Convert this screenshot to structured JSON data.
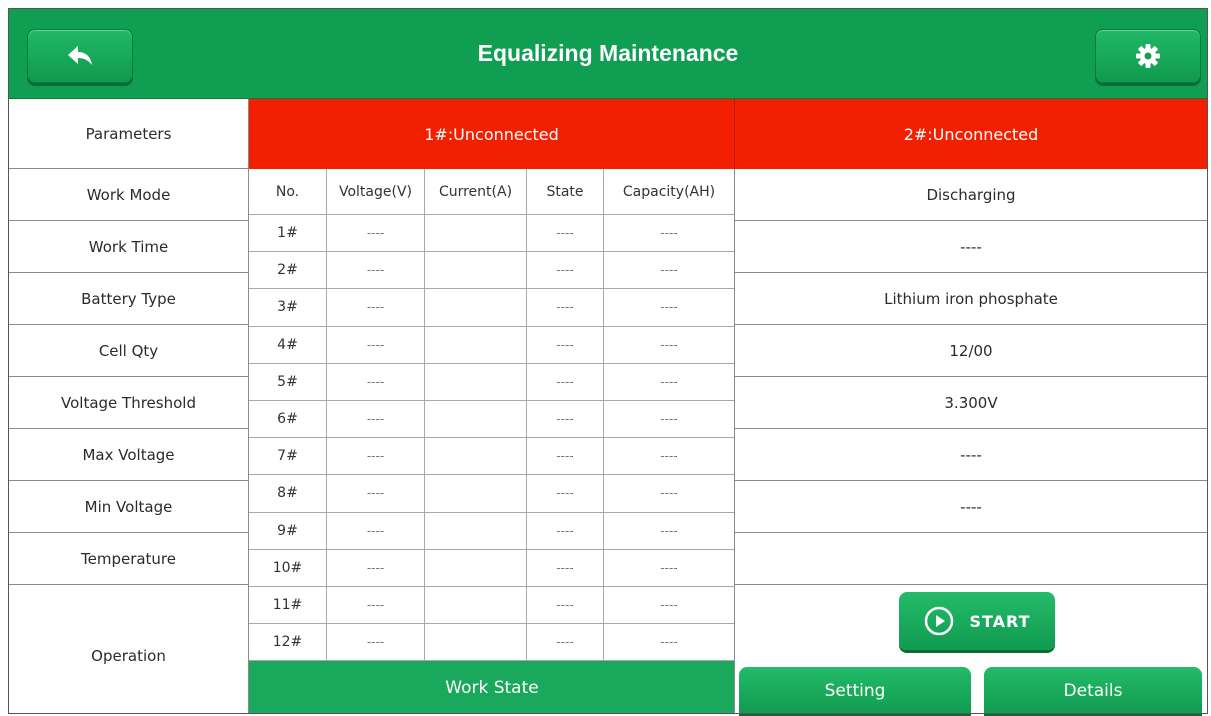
{
  "header": {
    "title": "Equalizing Maintenance",
    "back_icon": "back-arrow-icon",
    "settings_icon": "gear-icon"
  },
  "parameters": {
    "header": "Parameters",
    "labels": [
      "Work Mode",
      "Work Time",
      "Battery Type",
      "Cell Qty",
      "Voltage Threshold",
      "Max Voltage",
      "Min Voltage",
      "Temperature",
      "Operation"
    ]
  },
  "channel1": {
    "title": "1#:Unconnected"
  },
  "channel2": {
    "title": "2#:Unconnected",
    "values": [
      "Discharging",
      "----",
      "Lithium iron phosphate",
      "12/00",
      "3.300V",
      "----",
      "----",
      ""
    ]
  },
  "table": {
    "columns": [
      "No.",
      "Voltage(V)",
      "Current(A)",
      "State",
      "Capacity(AH)"
    ],
    "rows": [
      [
        "1#",
        "----",
        "",
        "----",
        "----"
      ],
      [
        "2#",
        "----",
        "",
        "----",
        "----"
      ],
      [
        "3#",
        "----",
        "",
        "----",
        "----"
      ],
      [
        "4#",
        "----",
        "",
        "----",
        "----"
      ],
      [
        "5#",
        "----",
        "",
        "----",
        "----"
      ],
      [
        "6#",
        "----",
        "",
        "----",
        "----"
      ],
      [
        "7#",
        "----",
        "",
        "----",
        "----"
      ],
      [
        "8#",
        "----",
        "",
        "----",
        "----"
      ],
      [
        "9#",
        "----",
        "",
        "----",
        "----"
      ],
      [
        "10#",
        "----",
        "",
        "----",
        "----"
      ],
      [
        "11#",
        "----",
        "",
        "----",
        "----"
      ],
      [
        "12#",
        "----",
        "",
        "----",
        "----"
      ]
    ]
  },
  "footer": {
    "work_state": "Work State",
    "start": "START",
    "setting": "Setting",
    "details": "Details"
  },
  "colors": {
    "header_green": "#0f9e52",
    "alert_red": "#f21f00"
  }
}
